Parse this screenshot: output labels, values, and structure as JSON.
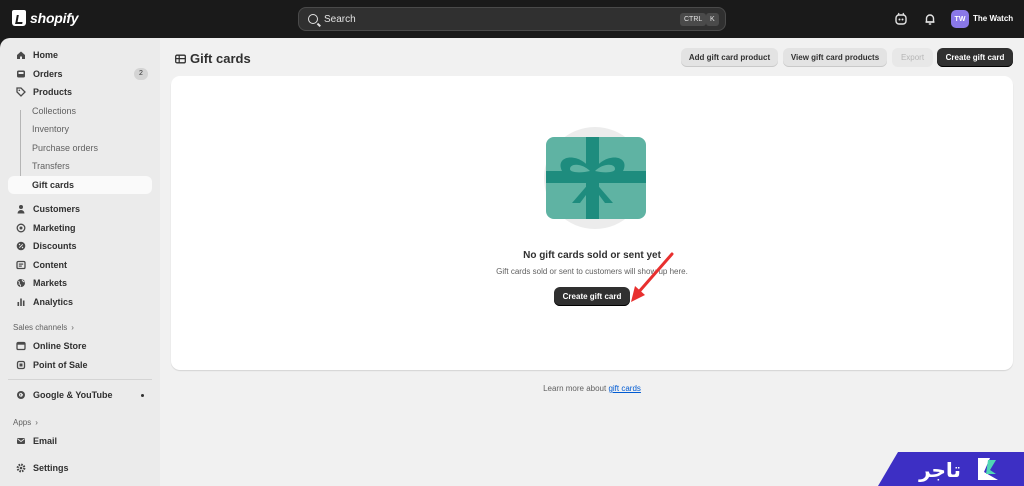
{
  "topbar": {
    "logo_text": "shopify",
    "search_placeholder": "Search",
    "shortcut_ctrl": "CTRL",
    "shortcut_k": "K",
    "avatar_initials": "TW",
    "store_name": "The Watch"
  },
  "sidebar": {
    "items": [
      {
        "label": "Home",
        "icon": "home-icon"
      },
      {
        "label": "Orders",
        "icon": "orders-icon",
        "badge": "2"
      },
      {
        "label": "Products",
        "icon": "tag-icon"
      },
      {
        "label": "Collections"
      },
      {
        "label": "Inventory"
      },
      {
        "label": "Purchase orders"
      },
      {
        "label": "Transfers"
      },
      {
        "label": "Gift cards",
        "active": true
      },
      {
        "label": "Customers",
        "icon": "person-icon"
      },
      {
        "label": "Marketing",
        "icon": "target-icon"
      },
      {
        "label": "Discounts",
        "icon": "discount-icon"
      },
      {
        "label": "Content",
        "icon": "content-icon"
      },
      {
        "label": "Markets",
        "icon": "globe-icon"
      },
      {
        "label": "Analytics",
        "icon": "bar-chart-icon"
      }
    ],
    "sales_channels_label": "Sales channels",
    "channels": [
      {
        "label": "Online Store",
        "icon": "store-icon"
      },
      {
        "label": "Point of Sale",
        "icon": "pos-icon"
      }
    ],
    "google_label": "Google & YouTube",
    "apps_label": "Apps",
    "email_label": "Email",
    "settings_label": "Settings"
  },
  "page": {
    "title": "Gift cards",
    "actions": {
      "add_product": "Add gift card product",
      "view_products": "View gift card products",
      "export": "Export",
      "create": "Create gift card"
    },
    "empty_state": {
      "title": "No gift cards sold or sent yet",
      "description": "Gift cards sold or sent to customers will show up here.",
      "button": "Create gift card"
    },
    "learn_more_prefix": "Learn more about",
    "learn_more_link": "gift cards"
  },
  "watermark": {
    "text": "تاجر"
  },
  "colors": {
    "accent": "#303030",
    "gift_card_teal": "#5fb3a3",
    "gift_card_ribbon": "#1e8c7e",
    "avatar": "#8a78e8",
    "watermark": "#3d2fc4",
    "link": "#005bd3",
    "annotation_arrow": "#e8302f"
  }
}
